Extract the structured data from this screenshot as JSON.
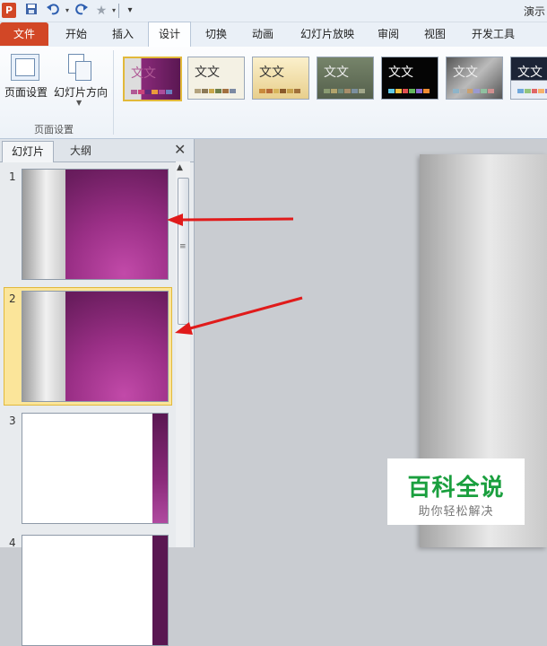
{
  "app": {
    "title": "演示",
    "logo_letter": "P"
  },
  "qat": {
    "save_icon": "save-icon",
    "undo_icon": "undo-icon",
    "redo_icon": "redo-icon",
    "star_icon": "star-icon",
    "customize_icon": "customize-icon"
  },
  "tabs": [
    {
      "label": "文件"
    },
    {
      "label": "开始"
    },
    {
      "label": "插入"
    },
    {
      "label": "设计"
    },
    {
      "label": "切换"
    },
    {
      "label": "动画"
    },
    {
      "label": "幻灯片放映"
    },
    {
      "label": "审阅"
    },
    {
      "label": "视图"
    },
    {
      "label": "开发工具"
    }
  ],
  "active_tab": "设计",
  "ribbon": {
    "page_setup_label": "页面设置",
    "orientation_label": "幻灯片方向",
    "group_label": "页面设置",
    "themes": [
      {
        "text": "文文",
        "colors": [
          "#b05a96",
          "#c9447b",
          "#5e2b7a",
          "#ea9a3b",
          "#ad4c9a",
          "#6a7fbf"
        ]
      },
      {
        "text": "文文",
        "colors": [
          "#b3a27d",
          "#8c7a57",
          "#c7a64a",
          "#6d7f4a",
          "#a27040",
          "#7c8aa3"
        ]
      },
      {
        "text": "文文",
        "colors": [
          "#c98a3b",
          "#b66a38",
          "#d7b45a",
          "#8a5a2a",
          "#c7a14b",
          "#a0703a"
        ]
      },
      {
        "text": "文文",
        "colors": [
          "#8a9b72",
          "#b1a36c",
          "#6f8a79",
          "#a88e6a",
          "#7b8f9e",
          "#a1a78a"
        ]
      },
      {
        "text": "文文",
        "colors": [
          "#5fc8e6",
          "#f0c040",
          "#e05050",
          "#63b55b",
          "#8a6ad0",
          "#f08c32"
        ]
      },
      {
        "text": "文文",
        "colors": [
          "#8fb4c8",
          "#b0b0b0",
          "#c9a070",
          "#9a9ad0",
          "#8fc0a0",
          "#d09090"
        ]
      },
      {
        "text": "文文",
        "colors": [
          "#6fa8dc",
          "#93c47d",
          "#e06666",
          "#f6b26b",
          "#8e7cc3",
          "#76a5af"
        ]
      }
    ]
  },
  "panel": {
    "tab_slides": "幻灯片",
    "tab_outline": "大纲",
    "close_glyph": "✕",
    "slides": [
      {
        "num": "1"
      },
      {
        "num": "2"
      },
      {
        "num": "3"
      },
      {
        "num": "4"
      }
    ]
  },
  "watermark": {
    "title": "百科全说",
    "subtitle": "助你轻松解决"
  },
  "colors": {
    "file_tab": "#d24726",
    "selection": "#fbe59a",
    "arrow": "#e01b1b",
    "slide_magenta": "#8a2a7a"
  }
}
